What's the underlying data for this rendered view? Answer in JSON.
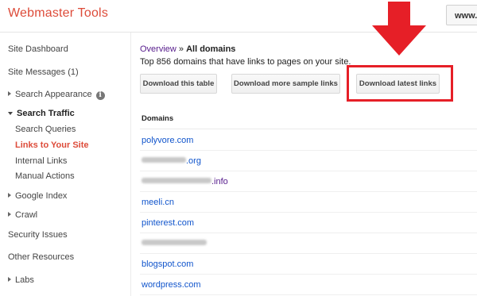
{
  "header": {
    "app_title": "Webmaster Tools",
    "site_selector": "www."
  },
  "sidebar": {
    "items": [
      {
        "label": "Site Dashboard"
      },
      {
        "label": "Site Messages (1)"
      },
      {
        "label": "Search Appearance"
      },
      {
        "label": "Search Traffic"
      },
      {
        "label": "Search Queries"
      },
      {
        "label": "Links to Your Site"
      },
      {
        "label": "Internal Links"
      },
      {
        "label": "Manual Actions"
      },
      {
        "label": "Google Index"
      },
      {
        "label": "Crawl"
      },
      {
        "label": "Security Issues"
      },
      {
        "label": "Other Resources"
      },
      {
        "label": "Labs"
      }
    ]
  },
  "breadcrumb": {
    "parent": "Overview",
    "separator": " » ",
    "current": "All domains"
  },
  "summary_text": "Top 856 domains that have links to pages on your site.",
  "buttons": {
    "download_table": "Download this table",
    "download_sample": "Download more sample links",
    "download_latest": "Download latest links"
  },
  "table": {
    "header": "Domains",
    "rows": [
      {
        "domain": "polyvore.com"
      },
      {
        "domain": ".org",
        "redacted": true
      },
      {
        "domain": ".info",
        "redacted": true
      },
      {
        "domain": "meeli.cn"
      },
      {
        "domain": "pinterest.com"
      },
      {
        "domain": "",
        "redacted": true
      },
      {
        "domain": "blogspot.com"
      },
      {
        "domain": "wordpress.com"
      }
    ]
  },
  "colors": {
    "accent_red": "#dd4b39",
    "highlight_red": "#e61f27",
    "link_blue": "#1155cc",
    "visited_purple": "#551a8b"
  }
}
